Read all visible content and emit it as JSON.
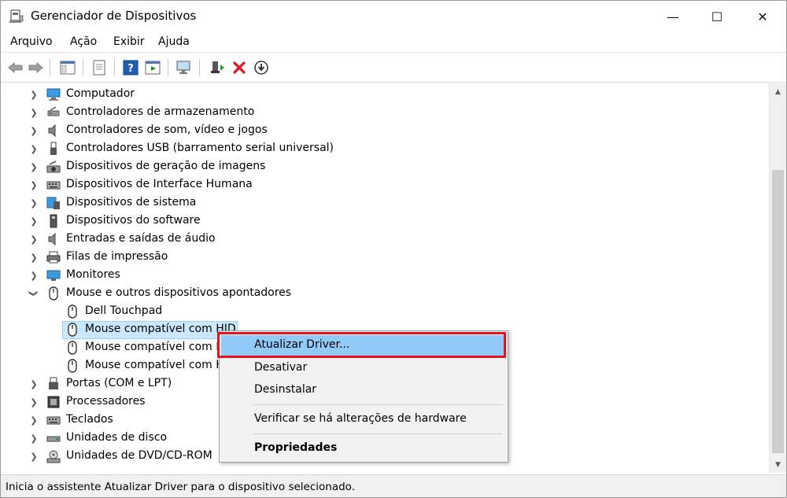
{
  "window": {
    "title": "Gerenciador de Dispositivos",
    "controls": {
      "minimize": "—",
      "maximize": "☐",
      "close": "✕"
    }
  },
  "menu": [
    "Arquivo",
    "Ação",
    "Exibir",
    "Ajuda"
  ],
  "toolbar": [
    {
      "icon": "back-arrow-icon"
    },
    {
      "icon": "forward-arrow-icon"
    },
    {
      "icon": "show-hide-console-tree-icon"
    },
    {
      "icon": "properties-sheet-icon"
    },
    {
      "icon": "help-icon"
    },
    {
      "icon": "action-pane-icon"
    },
    {
      "icon": "scan-hardware-icon"
    },
    {
      "icon": "update-driver-icon"
    },
    {
      "icon": "uninstall-red-x-icon"
    },
    {
      "icon": "disable-device-icon"
    }
  ],
  "tree": {
    "categories": [
      {
        "label": "Computador",
        "icon": "computer-icon"
      },
      {
        "label": "Controladores de armazenamento",
        "icon": "storage-controller-icon"
      },
      {
        "label": "Controladores de som, vídeo e jogos",
        "icon": "speaker-icon"
      },
      {
        "label": "Controladores USB (barramento serial universal)",
        "icon": "usb-icon"
      },
      {
        "label": "Dispositivos de geração de imagens",
        "icon": "camera-icon"
      },
      {
        "label": "Dispositivos de Interface Humana",
        "icon": "hid-icon"
      },
      {
        "label": "Dispositivos de sistema",
        "icon": "system-device-icon"
      },
      {
        "label": "Dispositivos do software",
        "icon": "software-device-icon"
      },
      {
        "label": "Entradas e saídas de áudio",
        "icon": "audio-io-icon"
      },
      {
        "label": "Filas de impressão",
        "icon": "printer-icon"
      },
      {
        "label": "Monitores",
        "icon": "monitor-icon"
      },
      {
        "label": "Mouse e outros dispositivos apontadores",
        "icon": "mouse-icon",
        "expanded": true
      }
    ],
    "mouse_children": [
      {
        "label": "Dell Touchpad"
      },
      {
        "label": "Mouse compatível com HID",
        "selected": true
      },
      {
        "label": "Mouse compatível com HID"
      },
      {
        "label": "Mouse compatível com HID"
      }
    ],
    "categories_after": [
      {
        "label": "Portas (COM e LPT)",
        "icon": "port-icon"
      },
      {
        "label": "Processadores",
        "icon": "processor-icon"
      },
      {
        "label": "Teclados",
        "icon": "keyboard-icon"
      },
      {
        "label": "Unidades de disco",
        "icon": "disk-drive-icon"
      },
      {
        "label": "Unidades de DVD/CD-ROM",
        "icon": "dvd-drive-icon"
      }
    ]
  },
  "context_menu": {
    "update_driver": "Atualizar Driver...",
    "disable": "Desativar",
    "uninstall": "Desinstalar",
    "scan": "Verificar se há alterações de hardware",
    "properties": "Propriedades"
  },
  "status": "Inicia o assistente Atualizar Driver para o dispositivo selecionado."
}
